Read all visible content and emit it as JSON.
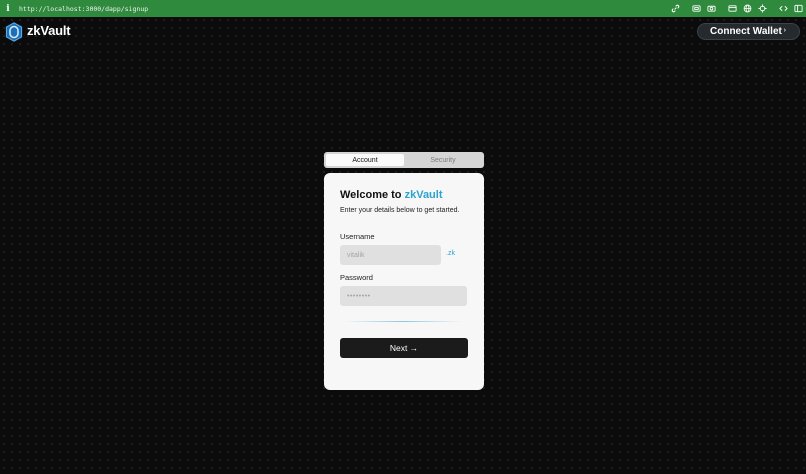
{
  "browser": {
    "info_glyph": "i",
    "url": "http://localhost:3000/dapp/signup",
    "toolbar_icons": [
      "link-icon",
      "screenshot-icon",
      "camera-icon",
      "window-icon",
      "globe-icon",
      "crosshair-icon",
      "code-icon",
      "panel-icon"
    ]
  },
  "header": {
    "brand": "zkVault",
    "connect_label": "Connect Wallet",
    "connect_chevron": "›"
  },
  "tabs": [
    {
      "label": "Account",
      "active": true
    },
    {
      "label": "Security",
      "active": false
    }
  ],
  "form": {
    "title_prefix": "Welcome to ",
    "title_brand": "zkVault",
    "subtitle": "Enter your details below to get started.",
    "username_label": "Username",
    "username_placeholder": "vitalik",
    "username_suffix": ".zk",
    "password_label": "Password",
    "password_placeholder": "••••••••",
    "next_label": "Next →"
  },
  "colors": {
    "accent": "#2ba3cc",
    "browser_bar": "#2f8a3e",
    "background": "#0b0b0b",
    "button": "#1b1b1b"
  }
}
